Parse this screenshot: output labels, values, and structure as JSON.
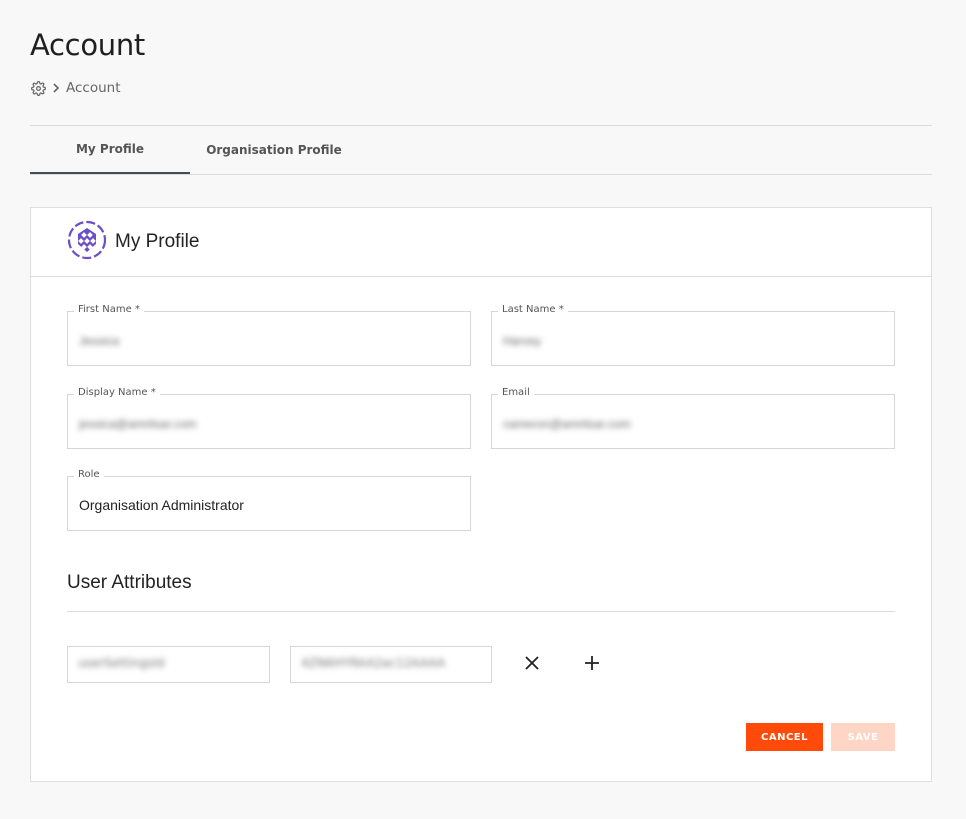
{
  "page": {
    "title": "Account"
  },
  "breadcrumb": {
    "current": "Account"
  },
  "tabs": [
    {
      "label": "My Profile",
      "active": true
    },
    {
      "label": "Organisation Profile",
      "active": false
    }
  ],
  "card": {
    "title": "My Profile",
    "fields": {
      "first_name": {
        "label": "First Name *",
        "value": "Jessica"
      },
      "last_name": {
        "label": "Last Name *",
        "value": "Harvey"
      },
      "display_name": {
        "label": "Display Name *",
        "value": "jessica@amritsar.com"
      },
      "email": {
        "label": "Email",
        "value": "cameron@amritsar.com"
      },
      "role": {
        "label": "Role",
        "value": "Organisation Administrator"
      }
    }
  },
  "user_attributes": {
    "title": "User Attributes",
    "items": [
      {
        "key": "userSettingsId",
        "value": "4ZN6HYRAA2ac12AAAA"
      }
    ]
  },
  "actions": {
    "cancel_label": "CANCEL",
    "save_label": "SAVE"
  },
  "colors": {
    "accent": "#ff4a0a",
    "accent_disabled": "#ffd6c6",
    "logo": "#6a4fc7"
  }
}
